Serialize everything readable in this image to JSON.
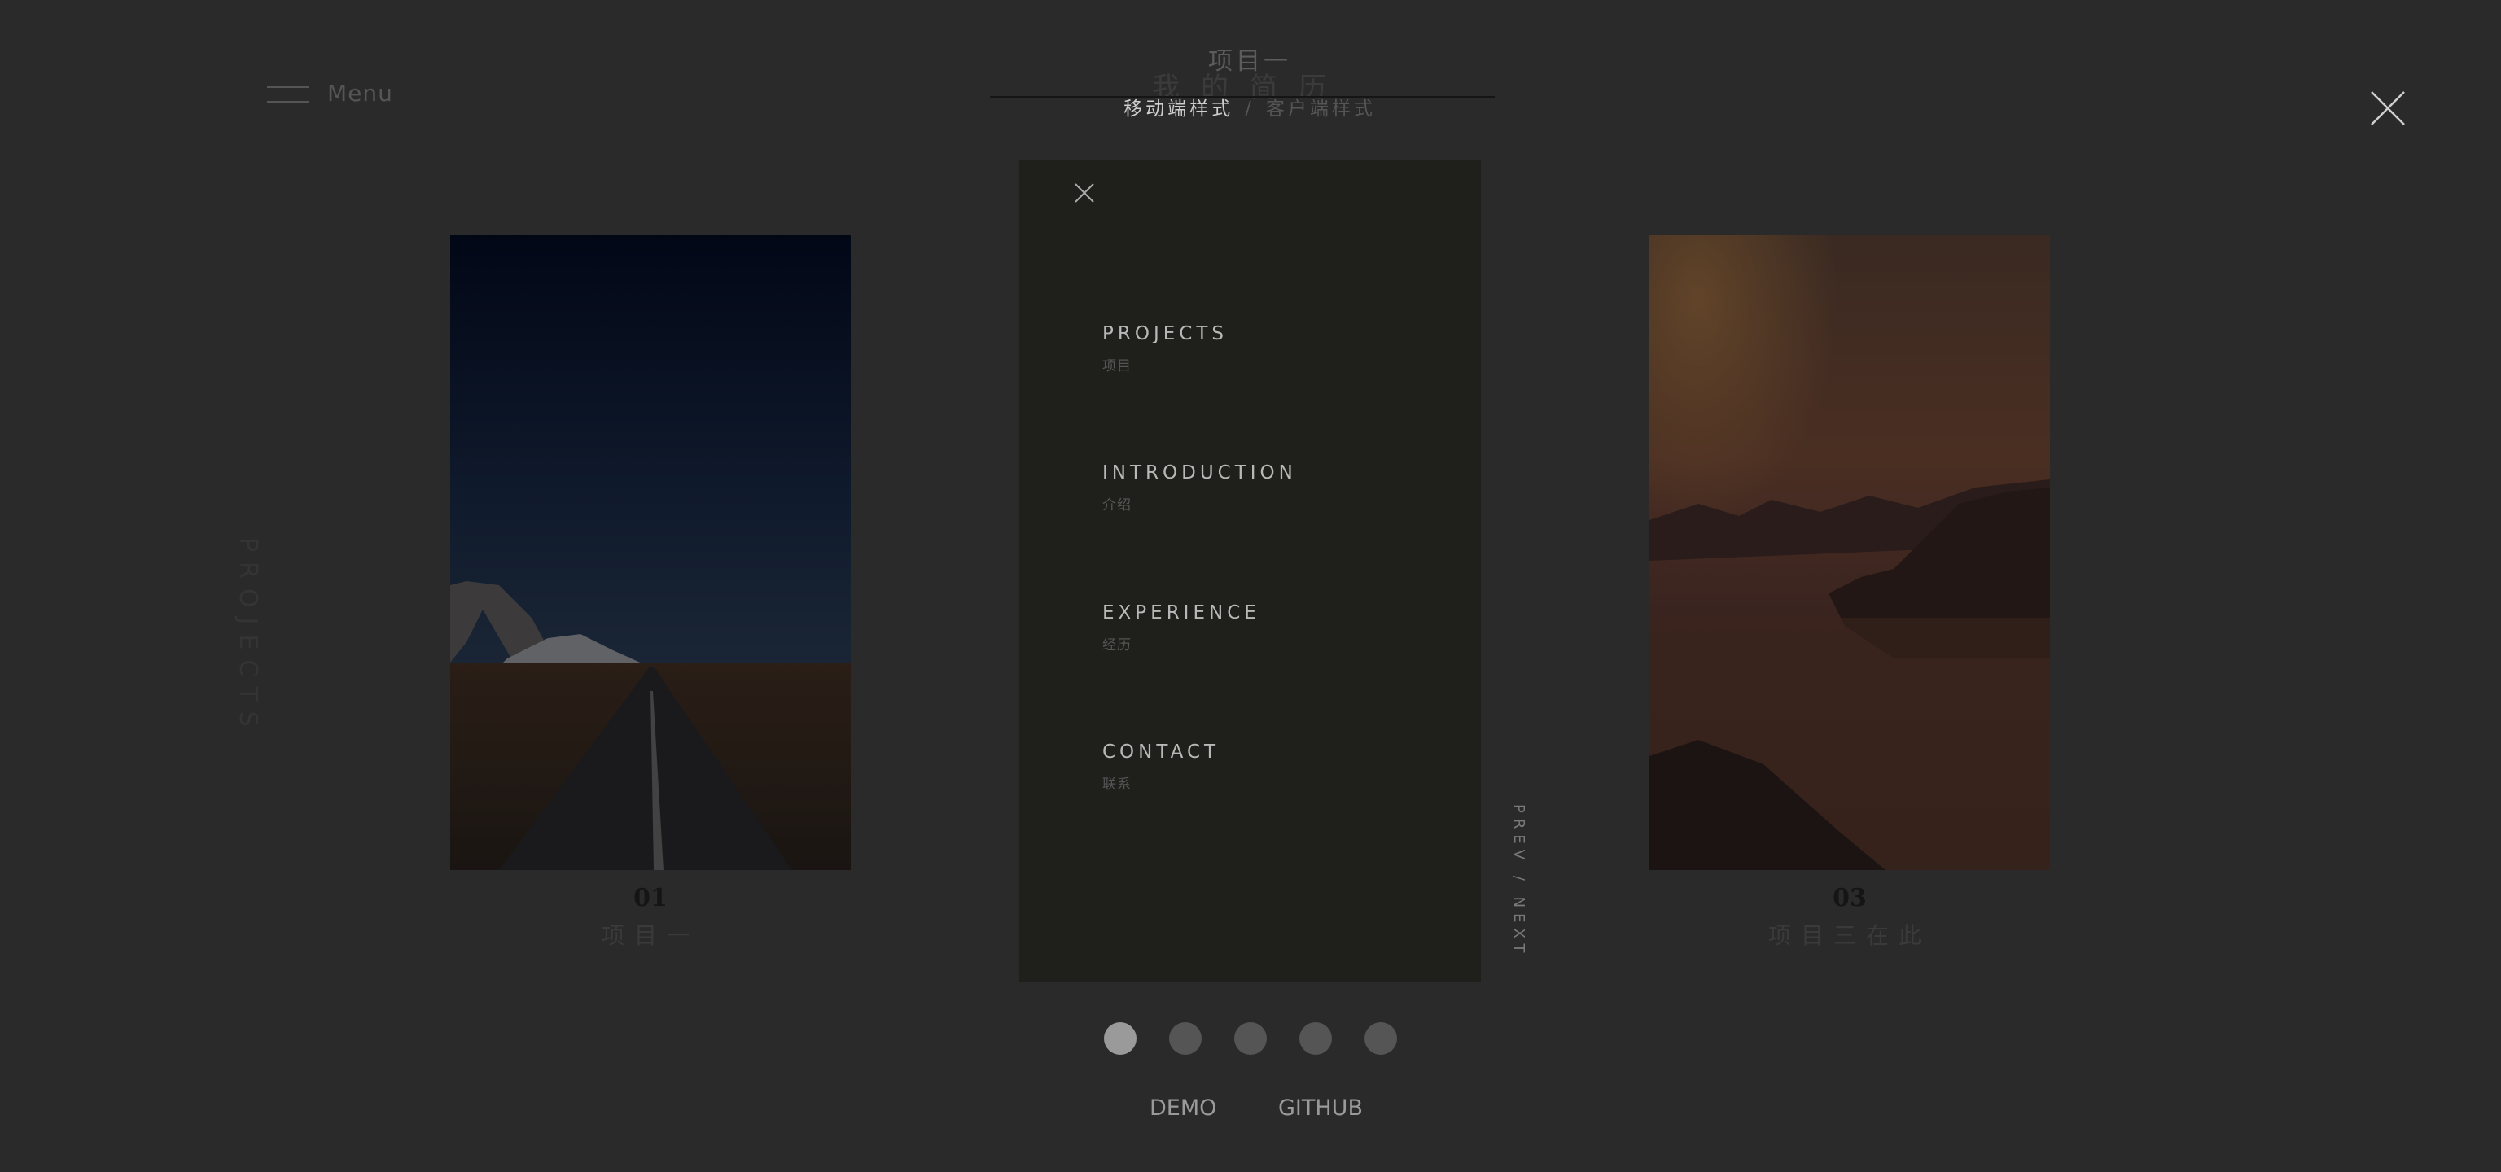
{
  "header": {
    "menu_label": "Menu",
    "project_heading": "项目一",
    "site_title": "我的简历",
    "style_active": "移动端样式",
    "style_separator": "/",
    "style_inactive": "客户端样式"
  },
  "side_label": "PROJECTS",
  "cards": [
    {
      "number": "01",
      "caption": "项目一"
    },
    {
      "number": "03",
      "caption": "项目三在此"
    }
  ],
  "drawer": {
    "items": [
      {
        "en": "PROJECTS",
        "zh": "项目"
      },
      {
        "en": "INTRODUCTION",
        "zh": "介绍"
      },
      {
        "en": "EXPERIENCE",
        "zh": "经历"
      },
      {
        "en": "CONTACT",
        "zh": "联系"
      }
    ]
  },
  "pager": {
    "prev": "PREV",
    "separator": "/",
    "next": "NEXT",
    "dot_count": 5,
    "active_index": 0
  },
  "links": {
    "demo": "DEMO",
    "github": "GITHUB"
  },
  "icons": [
    "hamburger-icon",
    "close-icon"
  ],
  "colors": {
    "background": "#2a2a2a",
    "drawer": "#1f1f1c",
    "active_dot": "#9a9a9a",
    "dot": "#555555"
  }
}
